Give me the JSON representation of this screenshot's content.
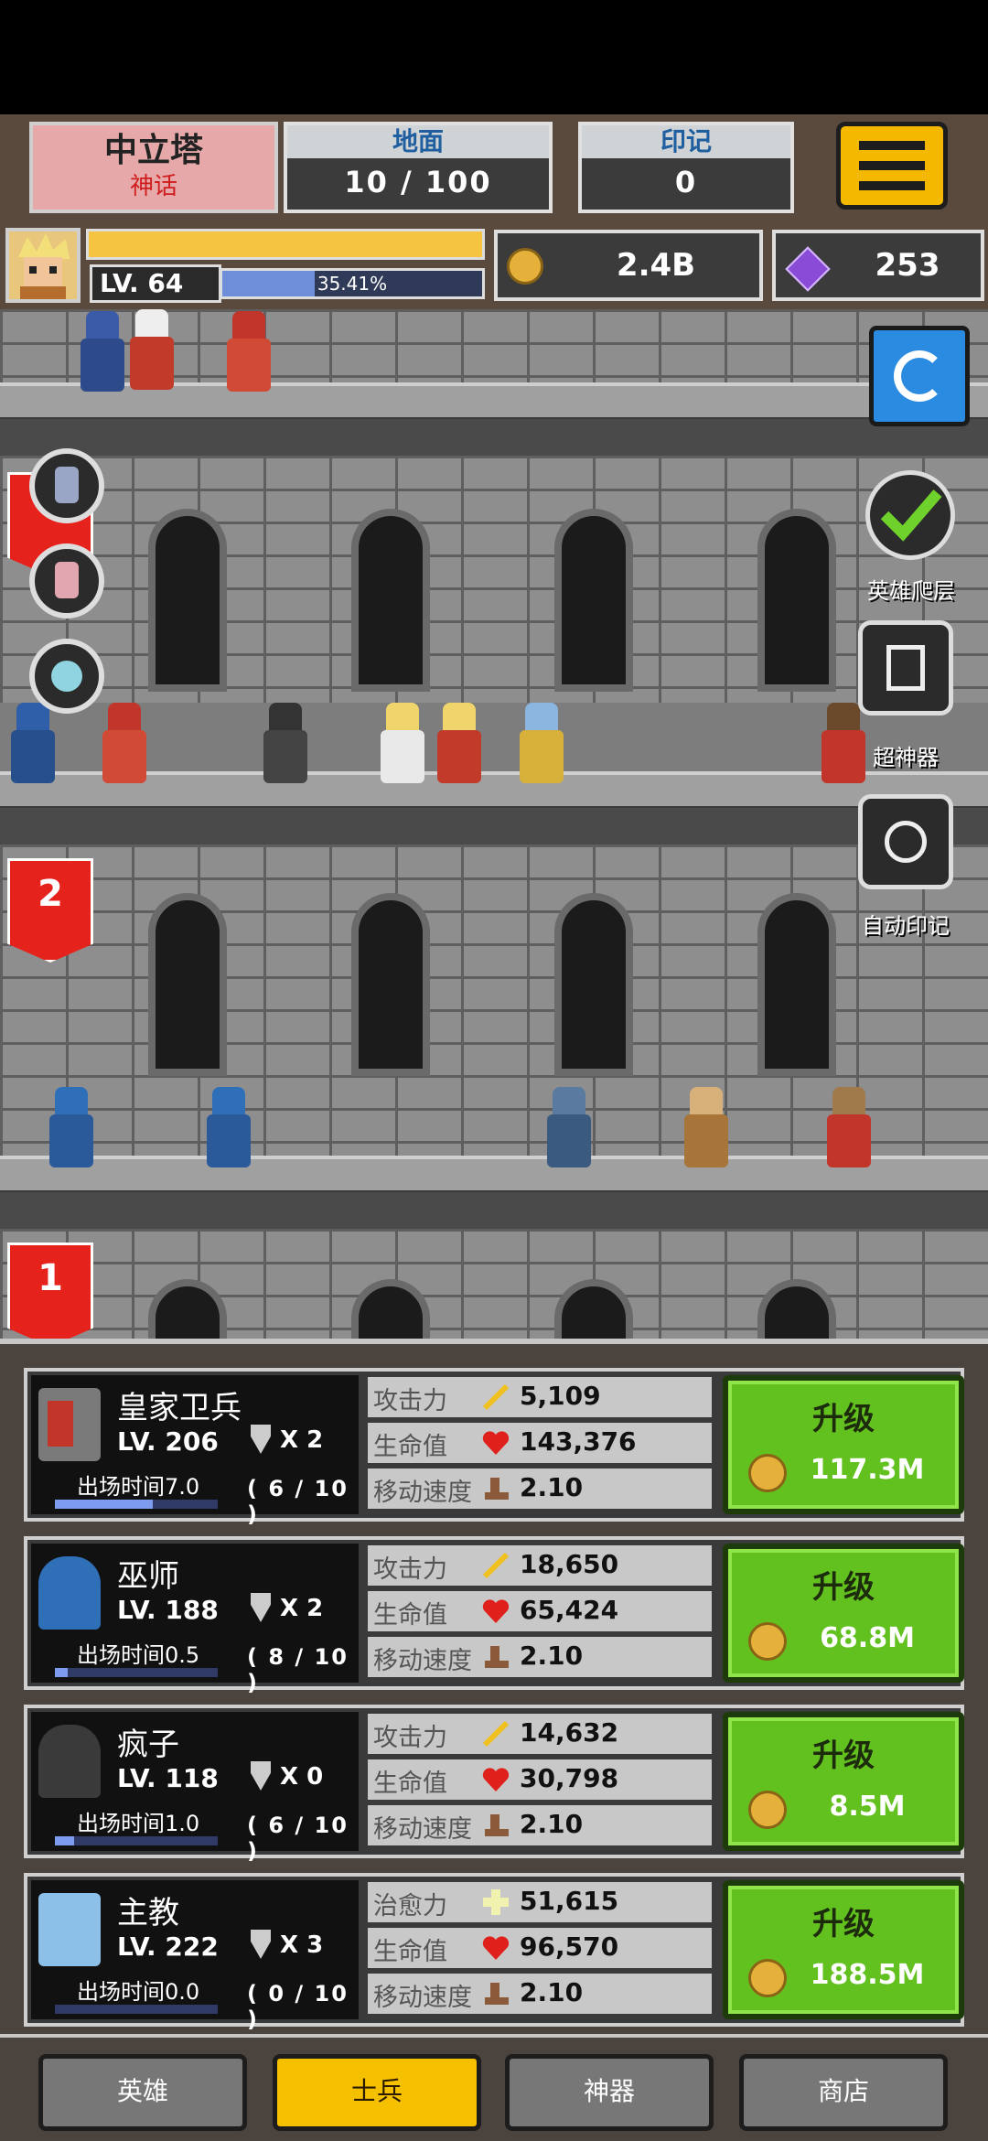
{
  "top": {
    "tower_name": "中立塔",
    "tower_sub": "神话",
    "floor_label": "地面",
    "floor_value": "10 / 100",
    "mark_label": "印记",
    "mark_value": "0"
  },
  "player": {
    "level": "LV. 64",
    "level_percent": "35.41%",
    "level_fraction": 0.3541,
    "gold": "2.4B",
    "gems": "253"
  },
  "tower": {
    "floor_banners": [
      "2",
      "1"
    ],
    "right_buttons": [
      {
        "label": "英雄爬层"
      },
      {
        "label": "超神器"
      },
      {
        "label": "自动印记"
      }
    ]
  },
  "units": [
    {
      "name": "皇家卫兵",
      "level": "LV. 206",
      "medal": "X 2",
      "spawn": "出场时间7.0",
      "progress": "( 6 / 10 )",
      "progress_fraction": 0.6,
      "stats": [
        {
          "key": "攻击力",
          "icon": "sword-icon",
          "value": "5,109"
        },
        {
          "key": "生命值",
          "icon": "heart-icon",
          "value": "143,376"
        },
        {
          "key": "移动速度",
          "icon": "boot-icon",
          "value": "2.10"
        }
      ],
      "upgrade_label": "升级",
      "upgrade_price": "117.3M"
    },
    {
      "name": "巫师",
      "level": "LV. 188",
      "medal": "X 2",
      "spawn": "出场时间0.5",
      "progress": "( 8 / 10 )",
      "progress_fraction": 0.08,
      "stats": [
        {
          "key": "攻击力",
          "icon": "sword-icon",
          "value": "18,650"
        },
        {
          "key": "生命值",
          "icon": "heart-icon",
          "value": "65,424"
        },
        {
          "key": "移动速度",
          "icon": "boot-icon",
          "value": "2.10"
        }
      ],
      "upgrade_label": "升级",
      "upgrade_price": "68.8M"
    },
    {
      "name": "疯子",
      "level": "LV. 118",
      "medal": "X 0",
      "spawn": "出场时间1.0",
      "progress": "( 6 / 10 )",
      "progress_fraction": 0.12,
      "stats": [
        {
          "key": "攻击力",
          "icon": "sword-icon",
          "value": "14,632"
        },
        {
          "key": "生命值",
          "icon": "heart-icon",
          "value": "30,798"
        },
        {
          "key": "移动速度",
          "icon": "boot-icon",
          "value": "2.10"
        }
      ],
      "upgrade_label": "升级",
      "upgrade_price": "8.5M"
    },
    {
      "name": "主教",
      "level": "LV. 222",
      "medal": "X 3",
      "spawn": "出场时间0.0",
      "progress": "( 0 / 10 )",
      "progress_fraction": 0.0,
      "stats": [
        {
          "key": "治愈力",
          "icon": "heal-cross-icon",
          "value": "51,615"
        },
        {
          "key": "生命值",
          "icon": "heart-icon",
          "value": "96,570"
        },
        {
          "key": "移动速度",
          "icon": "boot-icon",
          "value": "2.10"
        }
      ],
      "upgrade_label": "升级",
      "upgrade_price": "188.5M"
    }
  ],
  "tabs": [
    {
      "label": "英雄",
      "active": false
    },
    {
      "label": "士兵",
      "active": true
    },
    {
      "label": "神器",
      "active": false
    },
    {
      "label": "商店",
      "active": false
    }
  ],
  "colors": {
    "accent_gold": "#f5c000",
    "upgrade_green": "#62c11e",
    "banner_red": "#e5221b"
  }
}
